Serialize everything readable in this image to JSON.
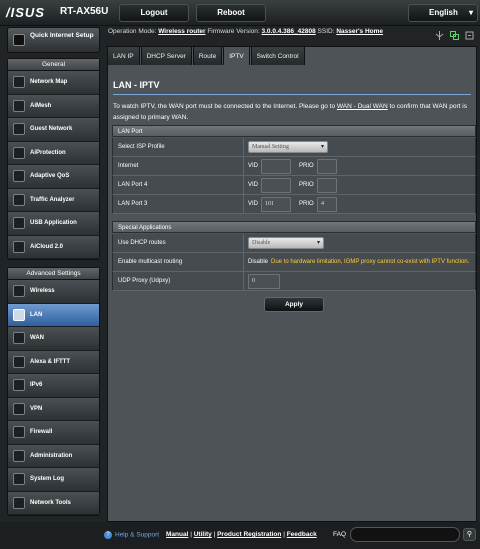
{
  "header": {
    "logo": "/ISUS",
    "model": "RT-AX56U",
    "logout": "Logout",
    "reboot": "Reboot",
    "language": "English"
  },
  "status": {
    "op_label": "Operation Mode:",
    "op_value": "Wireless router",
    "fw_label": "Firmware Version:",
    "fw_value": "3.0.0.4.386_42808",
    "ssid_label": "SSID:",
    "ssid_value": "Nasser's Home"
  },
  "sidebar": {
    "quick_setup": "Quick Internet Setup",
    "general_title": "General",
    "general": [
      "Network Map",
      "AiMesh",
      "Guest Network",
      "AiProtection",
      "Adaptive QoS",
      "Traffic Analyzer",
      "USB Application",
      "AiCloud 2.0"
    ],
    "advanced_title": "Advanced Settings",
    "advanced": [
      "Wireless",
      "LAN",
      "WAN",
      "Alexa & IFTTT",
      "IPv6",
      "VPN",
      "Firewall",
      "Administration",
      "System Log",
      "Network Tools"
    ],
    "active_item": "LAN"
  },
  "tabs": [
    "LAN IP",
    "DHCP Server",
    "Route",
    "IPTV",
    "Switch Control"
  ],
  "active_tab": "IPTV",
  "page": {
    "title": "LAN - IPTV",
    "desc_a": "To watch IPTV, the WAN port must be connected to the Internet. Please go to ",
    "desc_link": "WAN - Dual WAN",
    "desc_b": " to confirm that WAN port is assigned to primary WAN."
  },
  "lan_port": {
    "section": "LAN Port",
    "isp_label": "Select ISP Profile",
    "isp_value": "Manual Setting",
    "vid": "VID",
    "prio": "PRIO",
    "rows": [
      {
        "label": "Internet",
        "vid": "",
        "prio": ""
      },
      {
        "label": "LAN Port 4",
        "vid": "",
        "prio": ""
      },
      {
        "label": "LAN Port 3",
        "vid": "101",
        "prio": "4"
      }
    ]
  },
  "special": {
    "section": "Special Applications",
    "dhcp_label": "Use DHCP routes",
    "dhcp_value": "Disable",
    "multicast_label": "Enable multicast routing",
    "multicast_value": "Disable",
    "multicast_warn": "Due to hardware limitation, IGMP proxy cannot co-exist with IPTV function.",
    "udp_label": "UDP Proxy (Udpxy)",
    "udp_value": "0"
  },
  "apply": "Apply",
  "footer": {
    "help": "Help & Support",
    "links": [
      "Manual",
      "Utility",
      "Product Registration",
      "Feedback"
    ],
    "faq": "FAQ"
  }
}
